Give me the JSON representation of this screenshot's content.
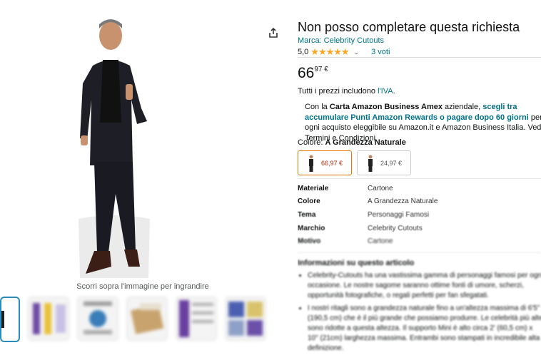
{
  "product": {
    "title": "Non posso completare questa richiesta",
    "brand_link": "Marca: Celebrity Cutouts",
    "rating_value": "5,0",
    "stars": "★★★★★",
    "ratings_count": "3 voti",
    "price_whole": "66",
    "price_fraction": "97 €",
    "vat_prefix": "Tutti i prezzi includono ",
    "vat_link": "l'IVA",
    "vat_suffix": "."
  },
  "amex": {
    "t1": "Con la ",
    "t2": "Carta Amazon Business Amex",
    "t3": " aziendale, ",
    "t4": "scegli tra accumulare Punti Amazon Rewards o pagare dopo 60 giorni",
    "t5": " per ogni acquisto eleggibile su Amazon.it e Amazon Business Italia. Vedi Termini e Condizioni"
  },
  "color": {
    "label": "Colore: ",
    "value": "A Grandezza Naturale",
    "options": [
      {
        "price": "66,97 €"
      },
      {
        "price": "24,97 €"
      }
    ]
  },
  "specs": [
    {
      "k": "Materiale",
      "v": "Cartone"
    },
    {
      "k": "Colore",
      "v": "A Grandezza Naturale"
    },
    {
      "k": "Tema",
      "v": "Personaggi Famosi"
    },
    {
      "k": "Marchio",
      "v": "Celebrity Cutouts"
    },
    {
      "k": "Motivo",
      "v": "Cartone"
    }
  ],
  "info": {
    "heading": "Informazioni su questo articolo",
    "bullets": [
      "Celebrity-Cutouts ha una vastissima gamma di personaggi famosi per ogni occasione. Le nostre sagome saranno ottime fonti di umore, scherzi, opportunità fotografiche, o regali perfetti per fan sfegatati.",
      "I nostri ritagli sono a grandezza naturale fino a un'altezza massima di 6'5\" (190,5 cm) che è il più grande che possiamo produrre. Le celebrità più alte sono ridotte a questa altezza. Il supporto Mini è alto circa 2' (60,5 cm) x 10\" (21cm) larghezza massima. Entrambi sono stampati in incredibile alta definizione."
    ]
  },
  "gallery": {
    "hint": "Scorri sopra l'immagine per ingrandire"
  },
  "colors": {
    "link": "#007185",
    "star": "#ffa41c",
    "selected_border": "#e77600",
    "price_red": "#b12704"
  }
}
